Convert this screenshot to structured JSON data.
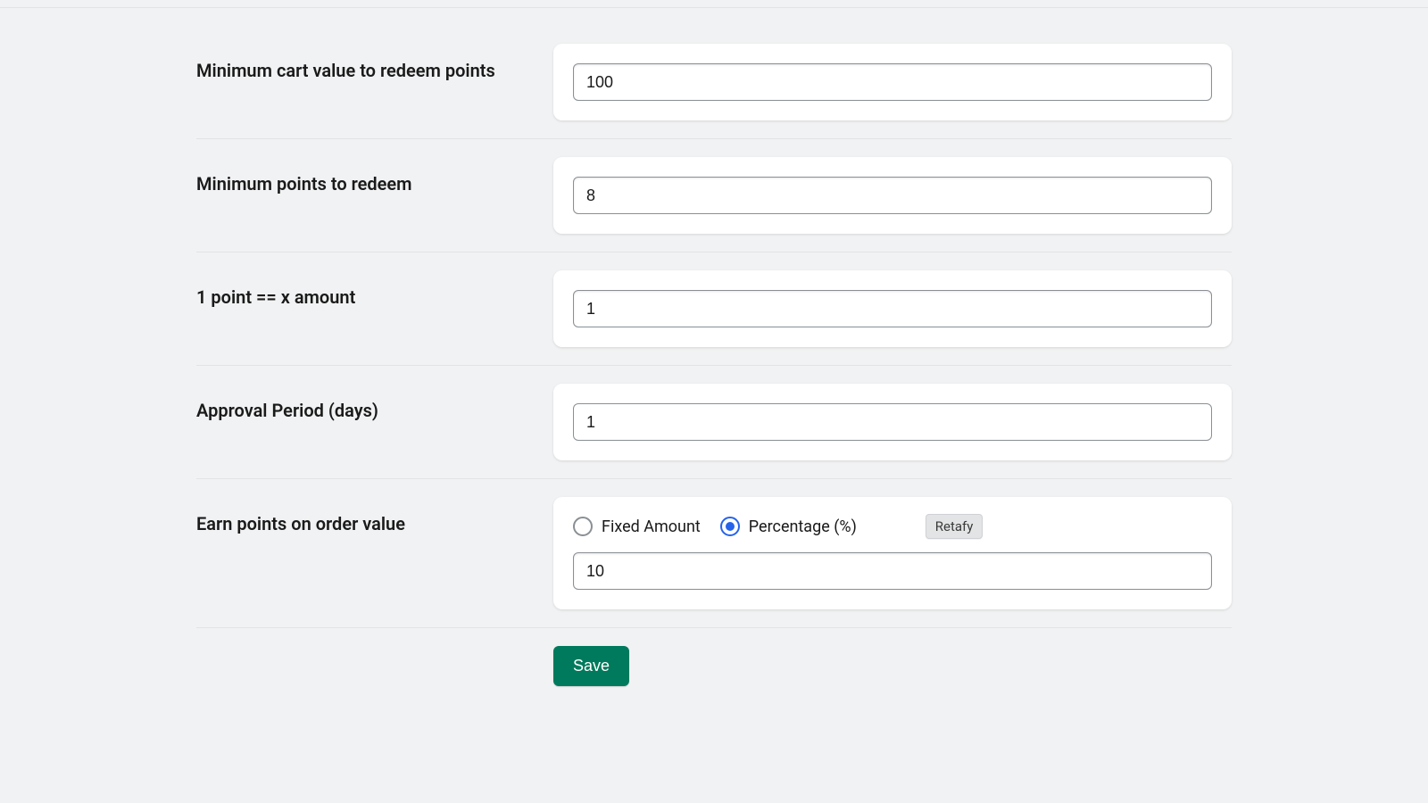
{
  "fields": {
    "min_cart": {
      "label": "Minimum cart value to redeem points",
      "value": "100"
    },
    "min_points": {
      "label": "Minimum points to redeem",
      "value": "8"
    },
    "point_amount": {
      "label": "1 point == x amount",
      "value": "1"
    },
    "approval_period": {
      "label": "Approval Period (days)",
      "value": "1"
    },
    "earn_points": {
      "label": "Earn points on order value",
      "option_fixed": "Fixed Amount",
      "option_percentage": "Percentage (%)",
      "value": "10",
      "chip": "Retafy"
    }
  },
  "buttons": {
    "save": "Save"
  }
}
